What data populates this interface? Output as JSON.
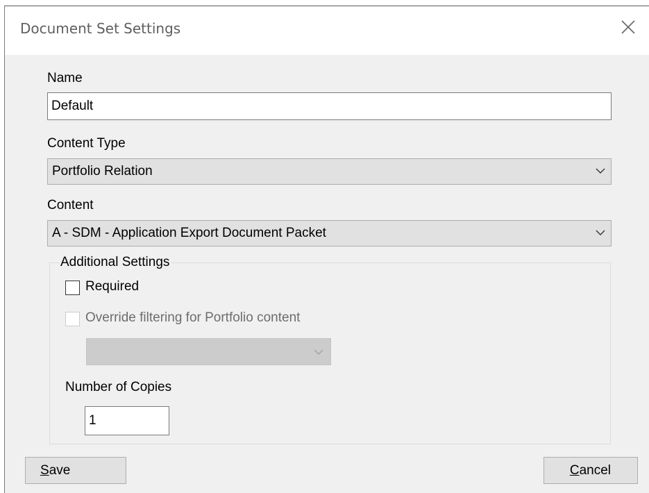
{
  "window": {
    "title": "Document Set Settings",
    "close_icon": "close-icon"
  },
  "form": {
    "name_label": "Name",
    "name_value": "Default",
    "content_type_label": "Content Type",
    "content_type_value": "Portfolio Relation",
    "content_label": "Content",
    "content_value": "A - SDM - Application Export Document Packet"
  },
  "additional_settings": {
    "legend": "Additional Settings",
    "required_label": "Required",
    "required_checked": false,
    "override_label": "Override filtering for Portfolio content",
    "override_checked": false,
    "override_enabled": false,
    "filter_value": "",
    "copies_label": "Number of Copies",
    "copies_value": "1"
  },
  "buttons": {
    "save_mnemonic": "S",
    "save_rest": "ave",
    "cancel_mnemonic": "C",
    "cancel_rest": "ancel"
  },
  "icons": {
    "dropdown": "chevron-down-icon",
    "close": "close-icon"
  },
  "colors": {
    "dialog_background": "#f0f0f0",
    "titlebar_background": "#ffffff",
    "button_background": "#e1e1e1",
    "disabled_text": "#6d6d6d"
  }
}
